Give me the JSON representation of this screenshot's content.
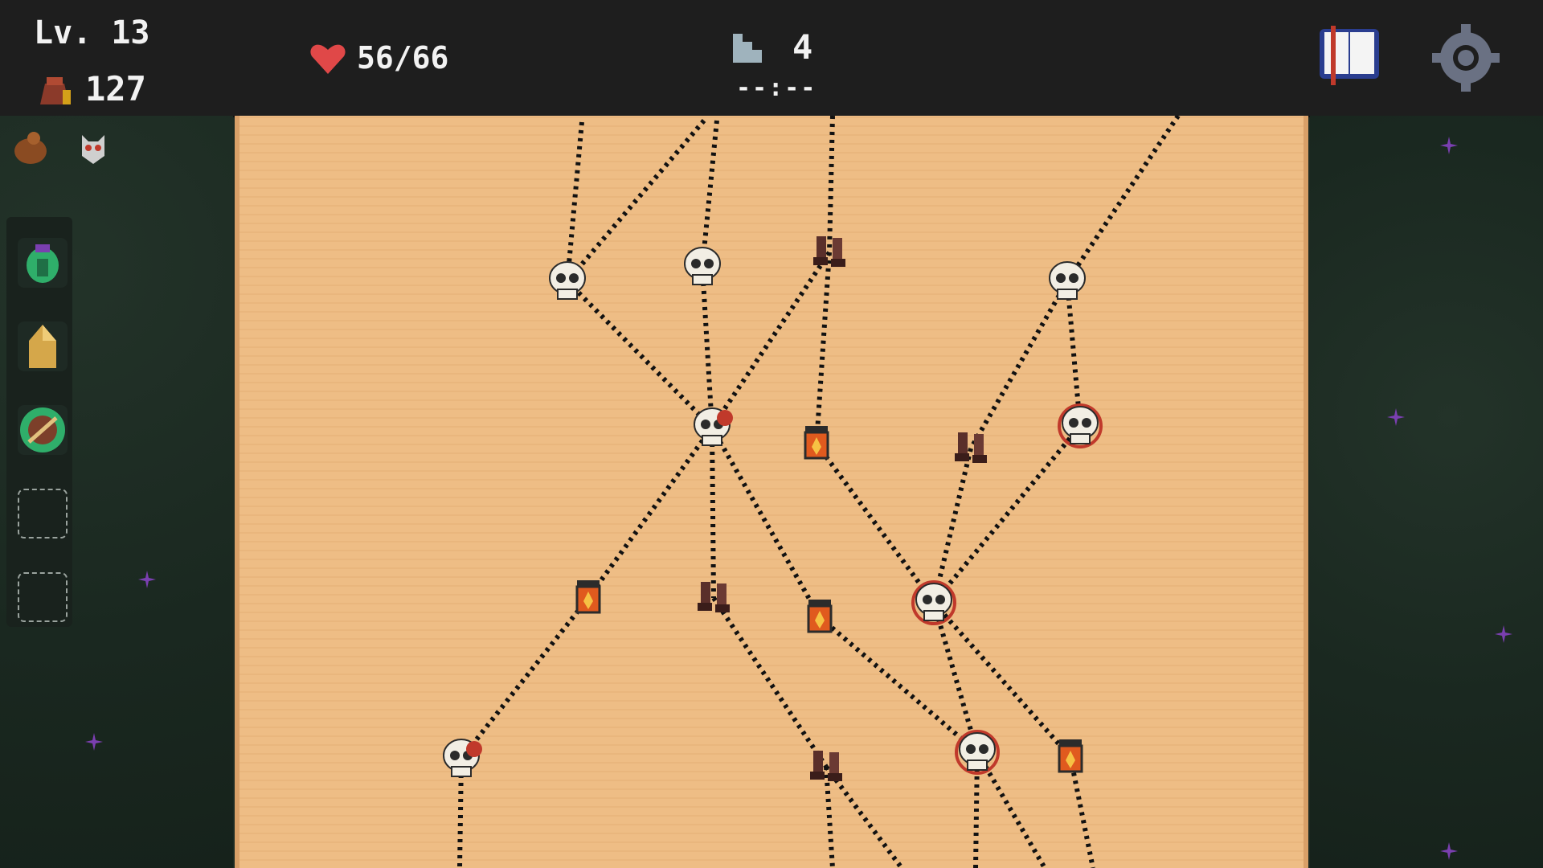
{
  "hud": {
    "level": "Lv. 13",
    "gold": "127",
    "health": "56/66",
    "floor": "4",
    "timer": "--:--"
  },
  "icons": {
    "gold": "coin-pouch-icon",
    "health": "heart-icon",
    "floor": "stairs-icon",
    "codex": "book-icon",
    "settings": "gear-icon",
    "pouch": "pouch-icon",
    "owl": "owl-icon",
    "potion": "potion-icon",
    "shield": "shield-icon",
    "bow": "bow-icon"
  },
  "map": {
    "node_types": [
      "skull",
      "elite-skull",
      "cursed-skull",
      "boots",
      "lantern"
    ],
    "colors": {
      "parchment": "#eebd85",
      "forest": "#1d2a23",
      "path": "#111111",
      "elite": "#c0392b"
    }
  },
  "inventory": {
    "slots": [
      "potion",
      "crystal",
      "bow",
      "empty",
      "empty"
    ]
  }
}
